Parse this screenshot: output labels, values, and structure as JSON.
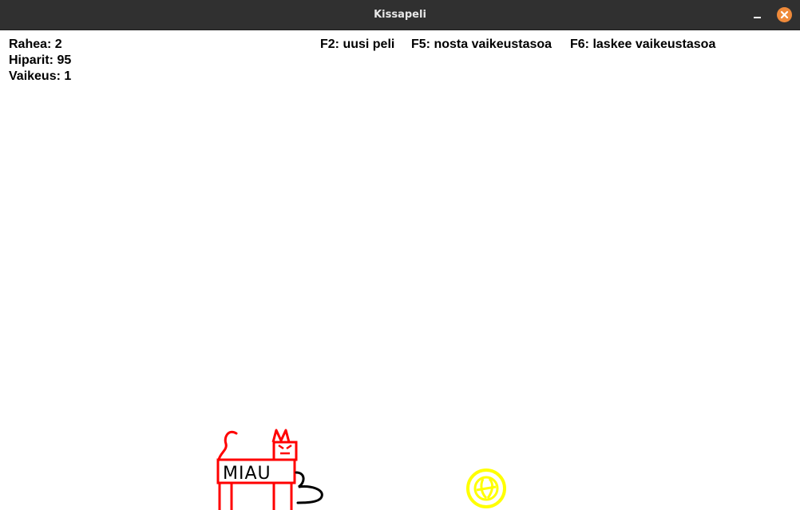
{
  "window": {
    "title": "Kissapeli"
  },
  "hud": {
    "money": "Rahea: 2",
    "mice": "Hiparit: 95",
    "difficulty": "Vaikeus: 1"
  },
  "controls": {
    "new_game": "F2: uusi peli",
    "raise_difficulty": "F5: nosta vaikeustasoa",
    "lower_difficulty": "F6: laskee vaikeustasoa"
  },
  "cat": {
    "sign_text": "MIAU",
    "body_color": "#ff0000",
    "tail_color": "#000000"
  },
  "coin": {
    "color": "#ffff00"
  },
  "colors": {
    "titlebar": "#303030",
    "close_button": "#ef8a3a",
    "background": "#ffffff"
  }
}
